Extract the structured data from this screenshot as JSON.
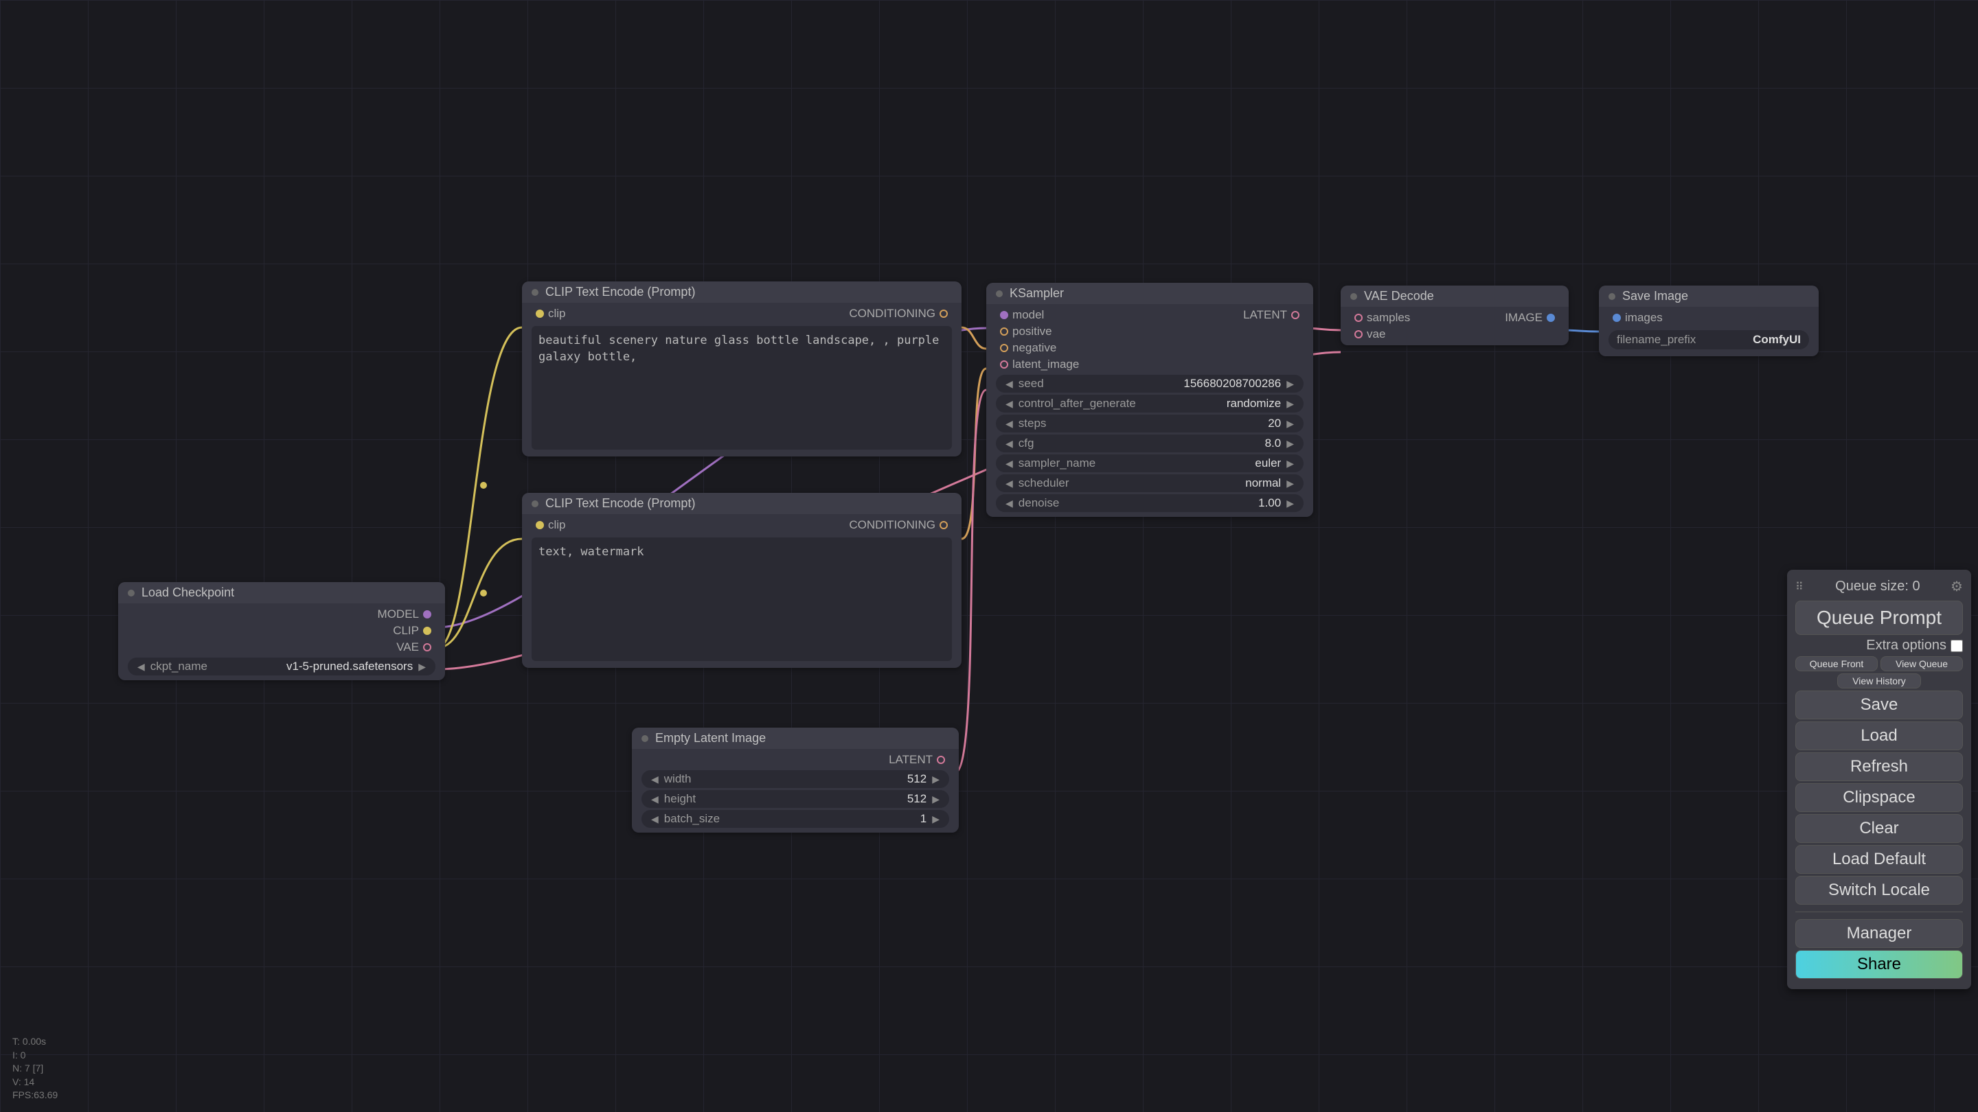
{
  "nodes": {
    "load_checkpoint": {
      "title": "Load Checkpoint",
      "outputs": {
        "model": "MODEL",
        "clip": "CLIP",
        "vae": "VAE"
      },
      "ckpt_name_label": "ckpt_name",
      "ckpt_name_value": "v1-5-pruned.safetensors"
    },
    "clip_pos": {
      "title": "CLIP Text Encode (Prompt)",
      "input_clip": "clip",
      "output_cond": "CONDITIONING",
      "text": "beautiful scenery nature glass bottle landscape, , purple galaxy bottle,"
    },
    "clip_neg": {
      "title": "CLIP Text Encode (Prompt)",
      "input_clip": "clip",
      "output_cond": "CONDITIONING",
      "text": "text, watermark"
    },
    "empty_latent": {
      "title": "Empty Latent Image",
      "output_latent": "LATENT",
      "width_label": "width",
      "width_value": "512",
      "height_label": "height",
      "height_value": "512",
      "batch_label": "batch_size",
      "batch_value": "1"
    },
    "ksampler": {
      "title": "KSampler",
      "inputs": {
        "model": "model",
        "positive": "positive",
        "negative": "negative",
        "latent_image": "latent_image"
      },
      "output_latent": "LATENT",
      "seed_label": "seed",
      "seed_value": "156680208700286",
      "ctrl_label": "control_after_generate",
      "ctrl_value": "randomize",
      "steps_label": "steps",
      "steps_value": "20",
      "cfg_label": "cfg",
      "cfg_value": "8.0",
      "sampler_label": "sampler_name",
      "sampler_value": "euler",
      "scheduler_label": "scheduler",
      "scheduler_value": "normal",
      "denoise_label": "denoise",
      "denoise_value": "1.00"
    },
    "vae_decode": {
      "title": "VAE Decode",
      "input_samples": "samples",
      "input_vae": "vae",
      "output_image": "IMAGE"
    },
    "save_image": {
      "title": "Save Image",
      "input_images": "images",
      "prefix_label": "filename_prefix",
      "prefix_value": "ComfyUI"
    }
  },
  "panel": {
    "queue_size": "Queue size: 0",
    "queue_prompt": "Queue Prompt",
    "extra_options": "Extra options",
    "queue_front": "Queue Front",
    "view_queue": "View Queue",
    "view_history": "View History",
    "save": "Save",
    "load": "Load",
    "refresh": "Refresh",
    "clipspace": "Clipspace",
    "clear": "Clear",
    "load_default": "Load Default",
    "switch_locale": "Switch Locale",
    "manager": "Manager",
    "share": "Share"
  },
  "stats": {
    "t": "T: 0.00s",
    "i": "I: 0",
    "n": "N: 7 [7]",
    "v": "V: 14",
    "fps": "FPS:63.69"
  }
}
